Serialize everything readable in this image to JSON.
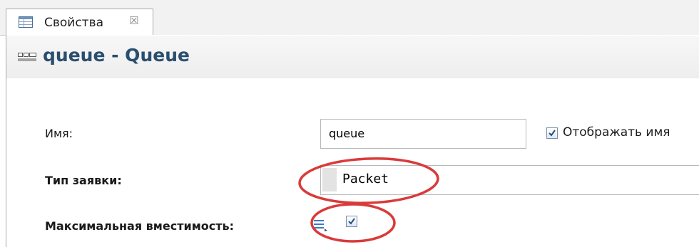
{
  "tab": {
    "label": "Свойства",
    "close_glyph": "☒"
  },
  "header": {
    "title": "queue - Queue",
    "icon": "queue-block-icon"
  },
  "form": {
    "name_label": "Имя:",
    "name_value": "queue",
    "display_name_label": "Отображать имя",
    "display_name_checked": true,
    "type_label": "Тип заявки:",
    "type_value": "Packet",
    "capacity_label": "Максимальная вместимость:",
    "capacity_checked": true
  },
  "colors": {
    "title": "#2a4e6e",
    "annotation": "#d93a3a",
    "header_bg": "#efefef"
  }
}
